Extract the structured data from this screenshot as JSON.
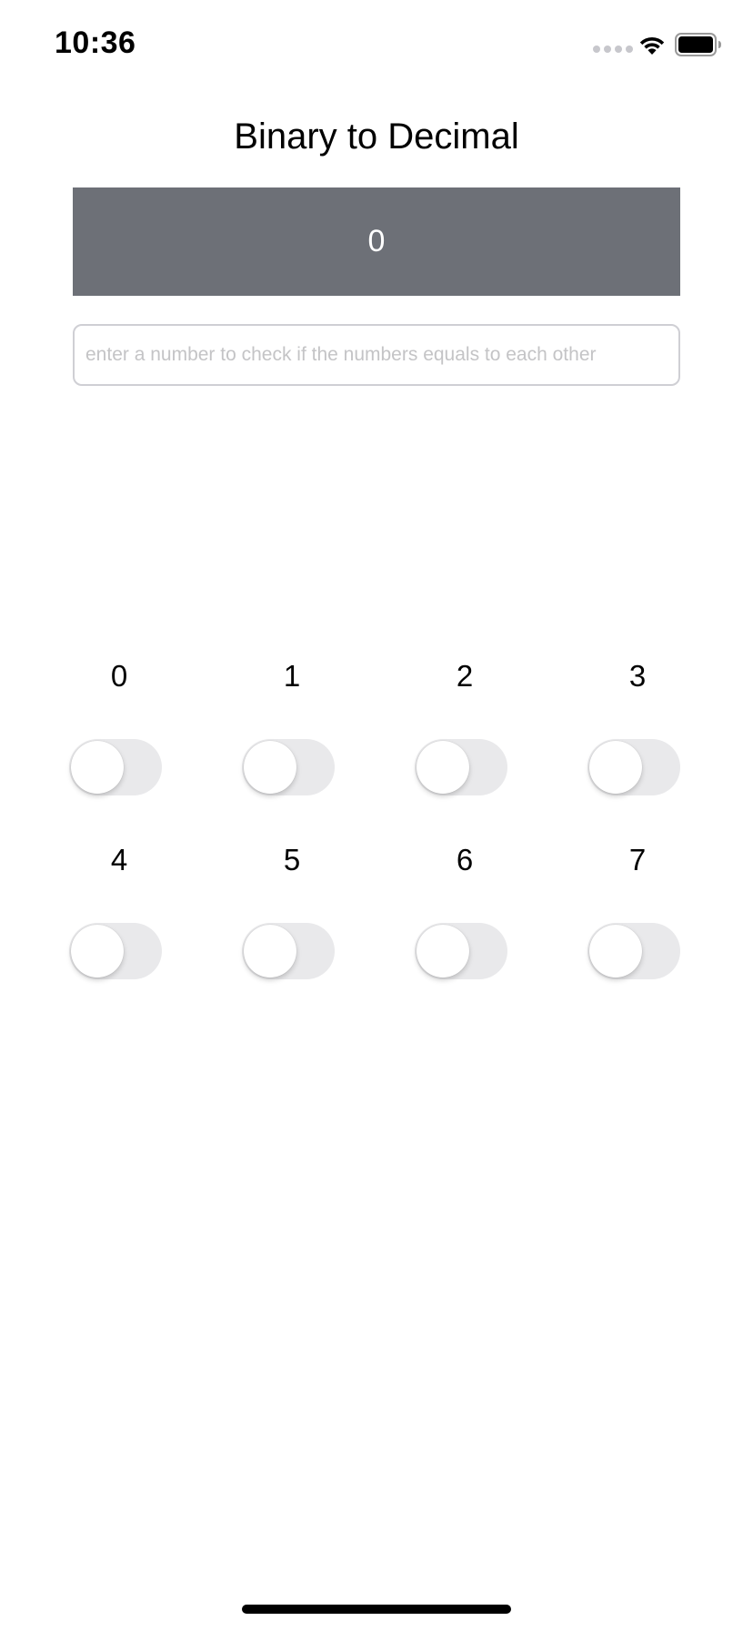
{
  "status_bar": {
    "time": "10:36",
    "icons": [
      "cellular-signal-icon",
      "wifi-icon",
      "battery-icon"
    ]
  },
  "title": "Binary to Decimal",
  "result": {
    "value": "0",
    "background_color": "#6d7077"
  },
  "check_input": {
    "value": "",
    "placeholder": "enter a number to check if the numbers equals to each other"
  },
  "bits": [
    {
      "label": "0",
      "on": false
    },
    {
      "label": "1",
      "on": false
    },
    {
      "label": "2",
      "on": false
    },
    {
      "label": "3",
      "on": false
    },
    {
      "label": "4",
      "on": false
    },
    {
      "label": "5",
      "on": false
    },
    {
      "label": "6",
      "on": false
    },
    {
      "label": "7",
      "on": false
    }
  ]
}
